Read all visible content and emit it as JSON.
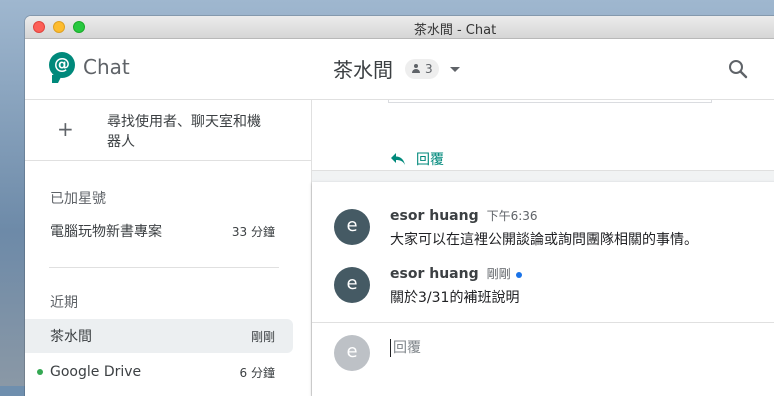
{
  "window": {
    "title": "茶水間 - Chat"
  },
  "header": {
    "app_name": "Chat",
    "room_title": "茶水間",
    "member_count": "3"
  },
  "sidebar": {
    "find_label": "尋找使用者、聊天室和機器人",
    "starred_label": "已加星號",
    "starred_items": [
      {
        "name": "電腦玩物新書專案",
        "time": "33 分鐘"
      }
    ],
    "recent_label": "近期",
    "recent_items": [
      {
        "name": "茶水間",
        "time": "剛剛",
        "active": true
      },
      {
        "name": "Google Drive",
        "time": "6 分鐘",
        "online": true
      }
    ]
  },
  "thread": {
    "reply_label": "回覆"
  },
  "messages": [
    {
      "avatar": "e",
      "sender": "esor huang",
      "time": "下午6:36",
      "text": "大家可以在這裡公開談論或詢問團隊相關的事情。"
    },
    {
      "avatar": "e",
      "sender": "esor huang",
      "time": "剛剛",
      "text": "關於3/31的補班說明"
    }
  ],
  "composer": {
    "avatar": "e",
    "placeholder": "回覆"
  },
  "colors": {
    "accent": "#00897b",
    "avatar": "#455a64",
    "online": "#34a853",
    "status": "#1a73e8"
  }
}
